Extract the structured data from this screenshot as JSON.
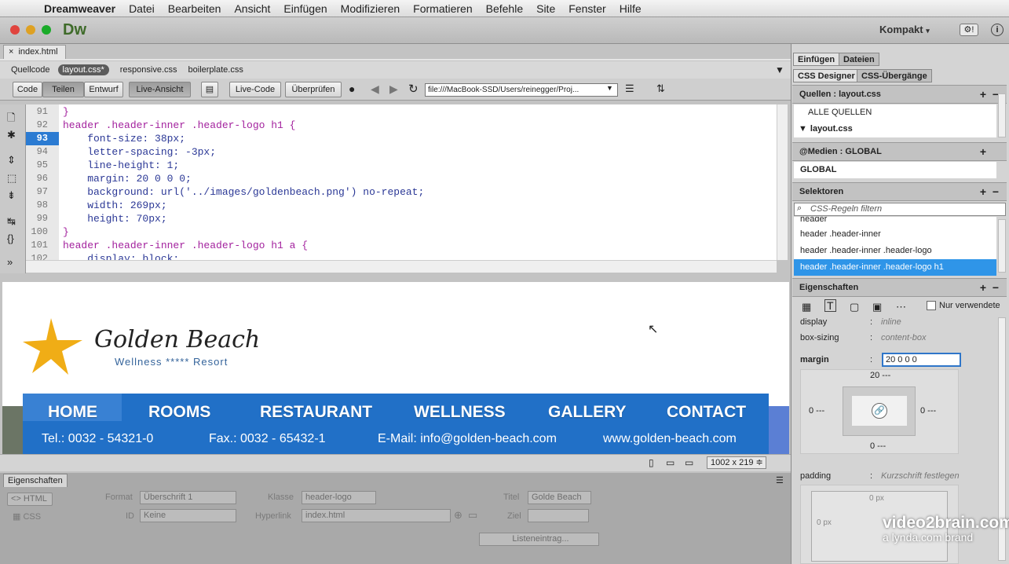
{
  "menubar": {
    "app": "Dreamweaver",
    "items": [
      "Datei",
      "Bearbeiten",
      "Ansicht",
      "Einfügen",
      "Modifizieren",
      "Formatieren",
      "Befehle",
      "Site",
      "Fenster",
      "Hilfe"
    ]
  },
  "titlebar": {
    "logo": "Dw",
    "workspace": "Kompakt"
  },
  "document": {
    "tab": "index.html",
    "related_files": [
      "Quellcode",
      "layout.css*",
      "responsive.css",
      "boilerplate.css"
    ],
    "toolbar": {
      "code": "Code",
      "split": "Teilen",
      "design": "Entwurf",
      "live": "Live-Ansicht",
      "livecode": "Live-Code",
      "inspect": "Überprüfen",
      "url": "file:///MacBook-SSD/Users/reinegger/Proj..."
    },
    "code_lines": [
      {
        "n": "91",
        "text": "}"
      },
      {
        "n": "92",
        "text": "header .header-inner .header-logo h1 {"
      },
      {
        "n": "93",
        "text": "    font-size: 38px;"
      },
      {
        "n": "94",
        "text": "    letter-spacing: -3px;"
      },
      {
        "n": "95",
        "text": "    line-height: 1;"
      },
      {
        "n": "96",
        "text": "    margin: 20 0 0 0;"
      },
      {
        "n": "97",
        "text": "    background: url('../images/goldenbeach.png') no-repeat;"
      },
      {
        "n": "98",
        "text": "    width: 269px;"
      },
      {
        "n": "99",
        "text": "    height: 70px;"
      },
      {
        "n": "100",
        "text": "}"
      },
      {
        "n": "101",
        "text": "header .header-inner .header-logo h1 a {"
      },
      {
        "n": "102",
        "text": "    display: block;"
      }
    ]
  },
  "design": {
    "logo_title": "Golden Beach",
    "logo_sub": "Wellness ***** Resort",
    "nav": [
      "HOME",
      "ROOMS",
      "RESTAURANT",
      "WELLNESS",
      "GALLERY",
      "CONTACT"
    ],
    "contact": [
      "Tel.: 0032 - 54321-0",
      "Fax.: 0032 - 65432-1",
      "E-Mail: info@golden-beach.com",
      "www.golden-beach.com"
    ],
    "size": "1002 x 219 ≑"
  },
  "properties": {
    "tab": "Eigenschaften",
    "html": "HTML",
    "css": "CSS",
    "format_label": "Format",
    "format_value": "Überschrift 1",
    "id_label": "ID",
    "id_value": "Keine",
    "class_label": "Klasse",
    "class_value": "header-logo",
    "link_label": "Hyperlink",
    "link_value": "index.html",
    "title_label": "Titel",
    "title_value": "Golde Beach",
    "target_label": "Ziel",
    "list_button": "Listeneintrag..."
  },
  "right": {
    "tabs": [
      "Einfügen",
      "Dateien"
    ],
    "tabs2": [
      "CSS Designer",
      "CSS-Übergänge"
    ],
    "sources_hdr": "Quellen : layout.css",
    "sources": [
      "ALLE QUELLEN",
      "layout.css"
    ],
    "media_hdr": "@Medien : GLOBAL",
    "media": "GLOBAL",
    "selectors_hdr": "Selektoren",
    "search_placeholder": "CSS-Regeln filtern",
    "selectors": [
      "header",
      "header .header-inner",
      "header .header-inner .header-logo",
      "header .header-inner .header-logo h1"
    ],
    "props_hdr": "Eigenschaften",
    "only_used": "Nur verwendete",
    "display_label": "display",
    "display_value": "inline",
    "boxsizing_label": "box-sizing",
    "boxsizing_value": "content-box",
    "margin_label": "margin",
    "margin_value": "20 0 0 0",
    "m_top": "20 ---",
    "m_left": "0 ---",
    "m_right": "0 ---",
    "m_bottom": "0 ---",
    "padding_label": "padding",
    "padding_value": "Kurzschrift festlegen",
    "p_top": "0 px",
    "p_left": "0 px"
  },
  "watermark": {
    "line1": "video2brain.com",
    "line2": "a lynda.com brand"
  }
}
